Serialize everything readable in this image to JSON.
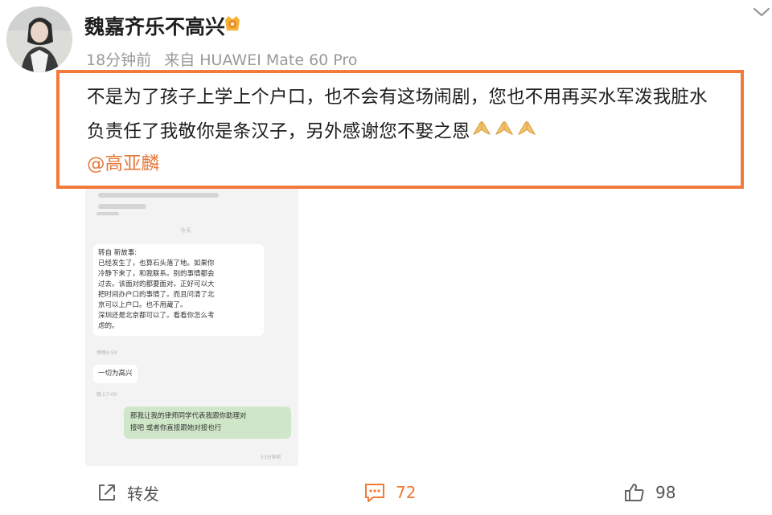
{
  "post": {
    "author": "魏嘉齐乐不高兴",
    "time": "18分钟前",
    "source": "来自 HUAWEI Mate 60 Pro",
    "text_line1": "不是为了孩子上学上个户口，也不会有这场闹剧，您也不用再买水军泼我脏水",
    "text_line2": "负责任了我敬你是条汉子，另外感谢您不娶之恩",
    "emojis": [
      "folded-hands-icon",
      "folded-hands-icon",
      "folded-hands-icon"
    ],
    "mention": "@高亚麟"
  },
  "chat_screenshot": {
    "date_label": "今天",
    "message1": {
      "header": "转自 新故事:",
      "lines": [
        "已经发生了，也算石头落了地。如果你",
        "冷静下来了，和我联系。别的事情都会",
        "过去。该面对的都要面对。正好可以大",
        "把时间办户口的事情了。而且问清了北",
        "京可以上户口。也不用藏了。",
        "深圳还是北京都可以了。看看你怎么考",
        "虑的。"
      ],
      "time": "傍晚6:59"
    },
    "message2": {
      "text": "一切为高兴",
      "time": "晚上7:00"
    },
    "message3": {
      "lines": [
        "那我让我的律师同学代表我跟你助理对",
        "接吧 或者你直接跟她对接也行"
      ],
      "time": "53分钟前"
    }
  },
  "actions": {
    "repost_label": "转发",
    "comment_count": "72",
    "like_count": "98"
  },
  "colors": {
    "highlight_border": "#f47a3c",
    "mention": "#e8773a",
    "comment_accent": "#f07a34"
  }
}
